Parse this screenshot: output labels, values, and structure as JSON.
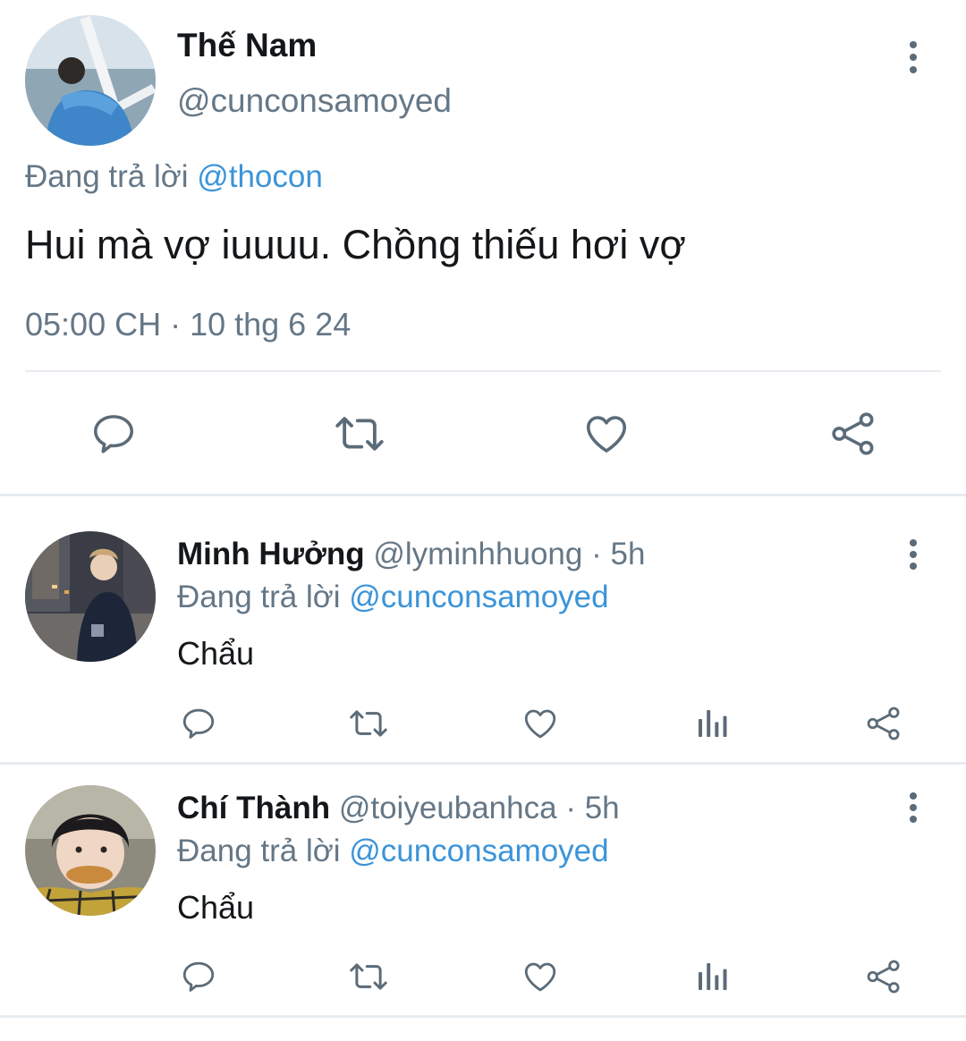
{
  "main_tweet": {
    "display_name": "Thế Nam",
    "handle": "@cunconsamoyed",
    "replying_prefix": "Đang trả lời",
    "replying_to": "@thocon",
    "text": "Hui mà vợ iuuuu. Chồng thiếu hơi vợ",
    "timestamp": "05:00 CH · 10 thg 6 24",
    "actions": [
      "reply-icon",
      "retweet-icon",
      "like-icon",
      "share-icon"
    ]
  },
  "replies": [
    {
      "display_name": "Minh Hưởng",
      "handle": "@lyminhhuong",
      "time": "· 5h",
      "replying_prefix": "Đang trả lời",
      "replying_to": "@cunconsamoyed",
      "text": "Chẩu",
      "actions": [
        "reply-icon",
        "retweet-icon",
        "like-icon",
        "analytics-icon",
        "share-icon"
      ]
    },
    {
      "display_name": "Chí Thành",
      "handle": "@toiyeubanhca",
      "time": "· 5h",
      "replying_prefix": "Đang trả lời",
      "replying_to": "@cunconsamoyed",
      "text": "Chẩu",
      "actions": [
        "reply-icon",
        "retweet-icon",
        "like-icon",
        "analytics-icon",
        "share-icon"
      ]
    }
  ],
  "colors": {
    "text": "#14171a",
    "secondary": "#657786",
    "mention": "#3b94d9",
    "icon": "#5b6b78",
    "divider": "#e6ecf0"
  }
}
